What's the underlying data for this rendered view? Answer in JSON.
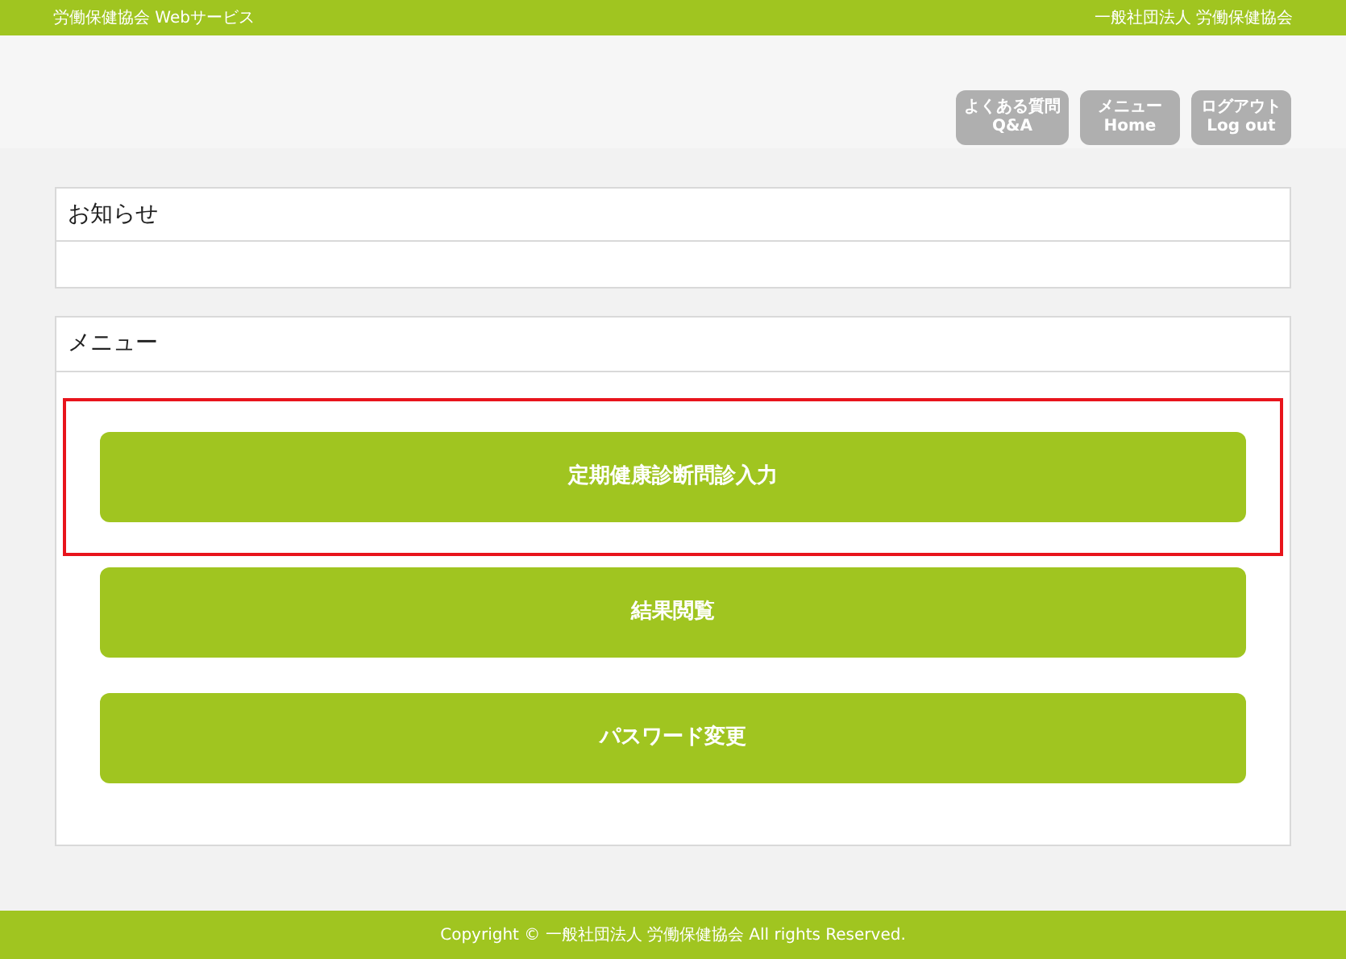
{
  "top_bar": {
    "site_name": "労働保健協会 Webサービス",
    "organization": "一般社団法人 労働保健協会"
  },
  "header_buttons": [
    {
      "label": "よくある質問",
      "sublabel": "Q&A"
    },
    {
      "label": "メニュー",
      "sublabel": "Home"
    },
    {
      "label": "ログアウト",
      "sublabel": "Log out"
    }
  ],
  "notice_panel": {
    "title": "お知らせ"
  },
  "menu_panel": {
    "title": "メニュー",
    "items": [
      {
        "label": "定期健康診断問診入力",
        "highlighted": true
      },
      {
        "label": "結果閲覧",
        "highlighted": false
      },
      {
        "label": "パスワード変更",
        "highlighted": false
      }
    ]
  },
  "footer": {
    "copyright": "Copyright © 一般社団法人 労働保健協会 All rights Reserved."
  }
}
